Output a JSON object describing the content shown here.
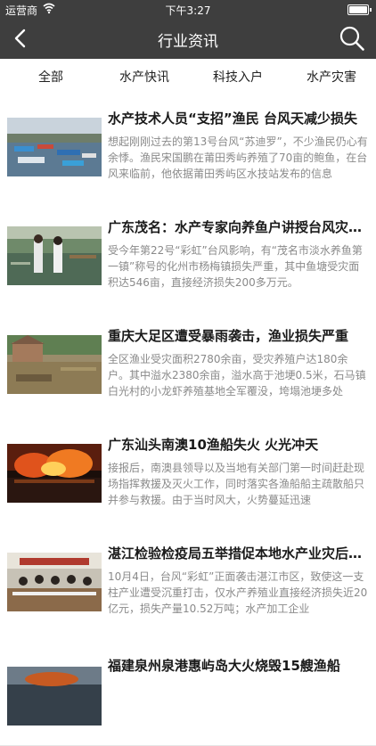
{
  "status": {
    "carrier": "运营商",
    "time": "下午3:27"
  },
  "header": {
    "title": "行业资讯"
  },
  "tabs": [
    {
      "label": "全部"
    },
    {
      "label": "水产快讯"
    },
    {
      "label": "科技入户"
    },
    {
      "label": "水产灾害"
    }
  ],
  "articles": [
    {
      "title": "水产技术人员“支招”渔民 台风天减少损失",
      "summary": "想起刚刚过去的第13号台风“苏迪罗”，不少渔民仍心有余悸。渔民宋国鹏在莆田秀屿养殖了70亩的鲍鱼，在台风来临前，他依据莆田秀屿区水技站发布的信息"
    },
    {
      "title": "广东茂名：水产专家向养鱼户讲授台风灾后复产技术",
      "summary": "受今年第22号“彩虹”台风影响，有“茂名市淡水养鱼第一镇”称号的化州市杨梅镇损失严重，其中鱼塘受灾面积达546亩，直接经济损失200多万元。"
    },
    {
      "title": "重庆大足区遭受暴雨袭击，渔业损失严重",
      "summary": "全区渔业受灾面积2780余亩，受灾养殖户达180余户。其中溢水2380余亩，溢水高于池埂0.5米，石马镇白光村的小龙虾养殖基地全军覆没，垮塌池埂多处"
    },
    {
      "title": "广东汕头南澳10渔船失火 火光冲天",
      "summary": "接报后，南澳县领导以及当地有关部门第一时间赶赴现场指挥救援及灭火工作，同时落实各渔船船主疏散船只并参与救援。由于当时风大，火势蔓延迅速"
    },
    {
      "title": "湛江检验检疫局五举措促本地水产业灾后恢复",
      "summary": "10月4日，台风“彩虹”正面袭击湛江市区，致使这一支柱产业遭受沉重打击，仅水产养殖业直接经济损失近20亿元，损失产量10.52万吨；水产加工企业"
    },
    {
      "title": "福建泉州泉港惠屿岛大火烧毁15艘渔船",
      "summary": ""
    }
  ]
}
